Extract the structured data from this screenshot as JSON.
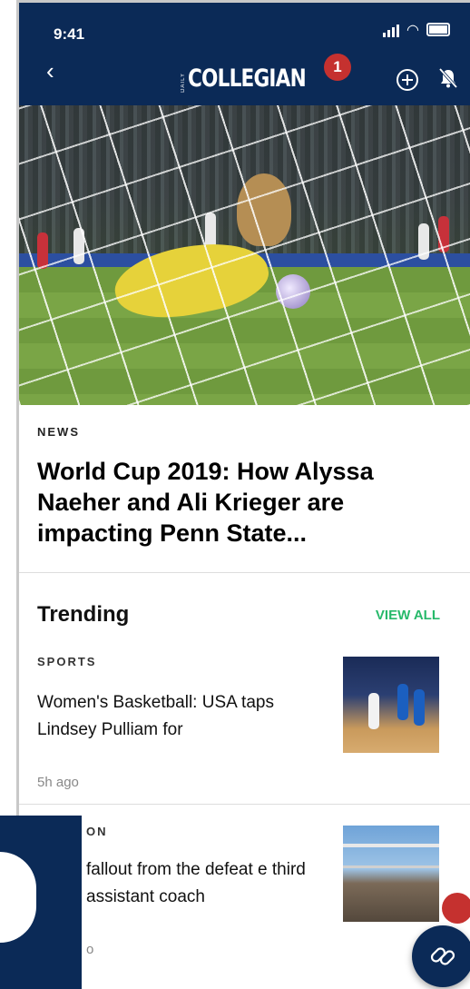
{
  "status_bar": {
    "time": "9:41"
  },
  "header": {
    "logo_small": "DAILY",
    "logo": "COLLEGIAN",
    "badge_number": "1",
    "icons": [
      "back-icon",
      "add-circle-icon",
      "bell-off-icon"
    ]
  },
  "featured": {
    "category": "NEWS",
    "headline": "World Cup 2019: How Alyssa Naeher and Ali Krieger are impacting Penn State..."
  },
  "trending": {
    "title": "Trending",
    "view_all": "VIEW ALL",
    "items": [
      {
        "category": "SPORTS",
        "title": "Women's Basketball: USA taps Lindsey Pulliam for",
        "time": "5h ago"
      },
      {
        "category": "ON",
        "title": "fallout from the defeat e third assistant coach",
        "time": "o"
      }
    ]
  },
  "colors": {
    "header_bg": "#0b2a57",
    "accent_green": "#27b96a",
    "badge_red": "#c5312f"
  }
}
